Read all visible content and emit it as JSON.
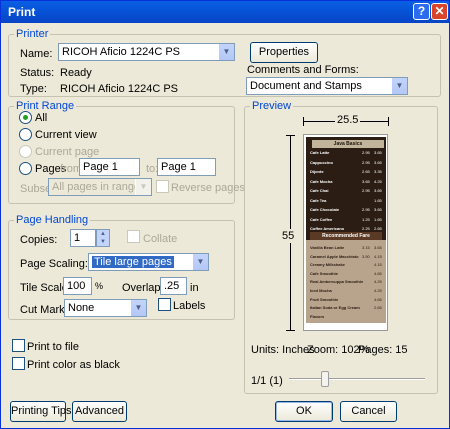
{
  "window": {
    "title": "Print"
  },
  "printer": {
    "legend": "Printer",
    "name_label": "Name:",
    "name_value": "RICOH Aficio 1224C PS",
    "properties_label": "Properties",
    "status_label": "Status:",
    "status_value": "Ready",
    "type_label": "Type:",
    "type_value": "RICOH Aficio 1224C PS",
    "comments_label": "Comments and Forms:",
    "comments_value": "Document and Stamps"
  },
  "range": {
    "legend": "Print Range",
    "all": "All",
    "current_view": "Current view",
    "current_page": "Current page",
    "pages": "Pages",
    "from": "from:",
    "from_value": "Page 1",
    "to": "to:",
    "to_value": "Page 1",
    "subset_label": "Subset:",
    "subset_value": "All pages in range",
    "reverse_pages": "Reverse pages"
  },
  "handling": {
    "legend": "Page Handling",
    "copies_label": "Copies:",
    "copies_value": "1",
    "collate": "Collate",
    "scaling_label": "Page Scaling:",
    "scaling_value": "Tile large pages",
    "tile_scale_label": "Tile Scale:",
    "tile_scale_value": "100",
    "tile_scale_unit": "%",
    "overlap_label": "Overlap:",
    "overlap_value": ".25",
    "overlap_unit": "in",
    "cut_marks_label": "Cut Marks:",
    "cut_marks_value": "None",
    "labels": "Labels"
  },
  "options": {
    "print_to_file": "Print to file",
    "print_color_black": "Print color as black"
  },
  "preview": {
    "legend": "Preview",
    "width_value": "25.5",
    "height_value": "55",
    "units": "Units: Inches",
    "zoom": "Zoom: 102%",
    "pages": "Pages: 15",
    "page_indicator": "1/1 (1)",
    "slider_fraction": 0.25,
    "menu_header_1": "Java Basics",
    "menu_header_2": "Recommended Fare",
    "menu_items_top": [
      {
        "name": "Cafe Latte",
        "p1": "2.95",
        "p2": "3.65"
      },
      {
        "name": "Cappuccino",
        "p1": "2.95",
        "p2": "3.65"
      },
      {
        "name": "Dijonte",
        "p1": "2.65",
        "p2": "3.35"
      },
      {
        "name": "Cafe Mocha",
        "p1": "3.65",
        "p2": "4.25"
      },
      {
        "name": "Cafe Chai",
        "p1": "2.95",
        "p2": "3.65"
      },
      {
        "name": "Cafe Tea",
        "p1": "",
        "p2": "1.65"
      },
      {
        "name": "Cafe Chocolate",
        "p1": "2.95",
        "p2": "3.65"
      },
      {
        "name": "Cafe Coffee",
        "p1": "1.25",
        "p2": "1.65"
      },
      {
        "name": "Coffee Americano",
        "p1": "2.25",
        "p2": "2.65"
      }
    ],
    "menu_items_bottom": [
      {
        "name": "Vanilla Bean Latte",
        "p1": "3.15",
        "p2": "3.65"
      },
      {
        "name": "Caramel Apple Macchiato",
        "p1": "3.50",
        "p2": "4.15"
      },
      {
        "name": "Creamy Milkshake",
        "p1": "",
        "p2": "4.15"
      },
      {
        "name": "Cafe Smoothie",
        "p1": "",
        "p2": "4.65"
      },
      {
        "name": "Real Ambercuppa Smoothie",
        "p1": "",
        "p2": "4.25"
      },
      {
        "name": "Iced Mocha",
        "p1": "",
        "p2": "4.25"
      },
      {
        "name": "Fruit Smoothie",
        "p1": "",
        "p2": "4.65"
      },
      {
        "name": "Italian Soda or Egg Cream",
        "p1": "",
        "p2": "2.65"
      },
      {
        "name": "Flavors",
        "p1": "",
        "p2": ""
      }
    ]
  },
  "buttons": {
    "printing_tips": "Printing Tips",
    "advanced": "Advanced",
    "ok": "OK",
    "cancel": "Cancel"
  },
  "colors": {
    "titlebar": "#0754d8",
    "legend_text": "#0046d5",
    "dialog_bg": "#ece9d8",
    "selection": "#316ac5"
  }
}
